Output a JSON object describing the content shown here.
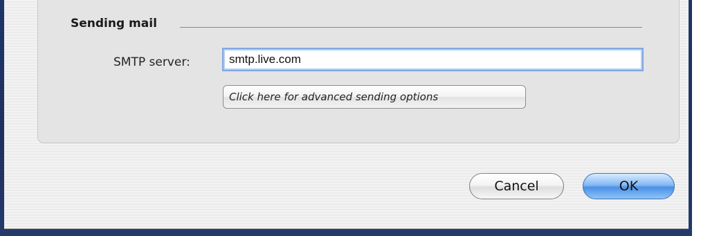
{
  "section": {
    "title": "Sending mail"
  },
  "smtp": {
    "label": "SMTP server:",
    "value": "smtp.live.com"
  },
  "advanced_button": {
    "label": "Click here for advanced sending options"
  },
  "buttons": {
    "cancel": "Cancel",
    "ok": "OK"
  },
  "colors": {
    "backdrop": "#1f3566",
    "ok_accent": "#4c91e6",
    "focus_ring": "#7ea7e0"
  }
}
